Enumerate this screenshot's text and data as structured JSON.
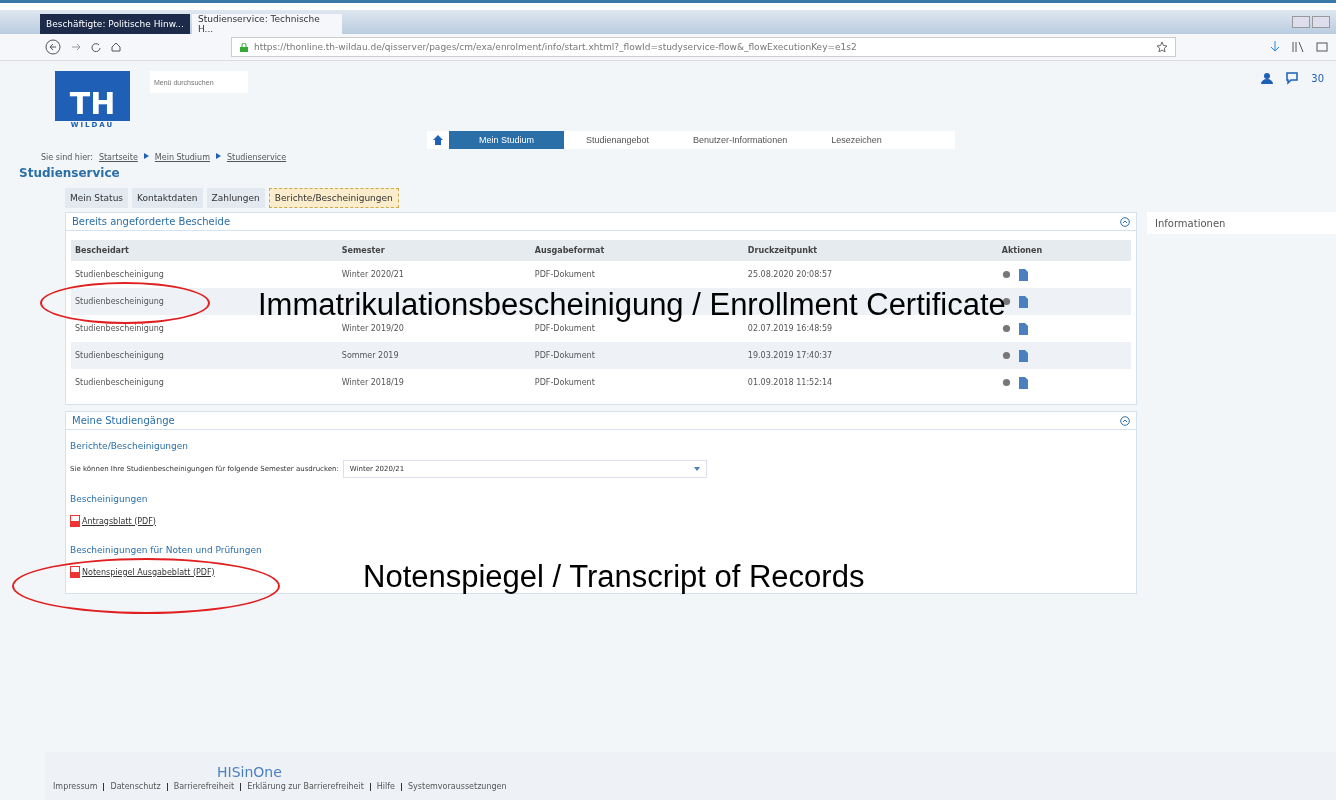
{
  "browser": {
    "tabs": [
      {
        "title": "Beschäftigte: Politische Hinw...",
        "selected": false
      },
      {
        "title": "Studienservice: Technische H...",
        "selected": true
      }
    ],
    "url": "https://thonline.th-wildau.de/qisserver/pages/cm/exa/enrolment/info/start.xhtml?_flowId=studyservice-flow&_flowExecutionKey=e1s2"
  },
  "header": {
    "logo_text": "TH",
    "logo_subtext": "WILDAU",
    "search": {
      "placeholder": "Menü durchsuchen"
    },
    "message_count": "30",
    "nav": [
      {
        "label": "Mein Studium",
        "selected": true
      },
      {
        "label": "Studienangebot",
        "selected": false
      },
      {
        "label": "Benutzer-Informationen",
        "selected": false
      },
      {
        "label": "Lesezeichen",
        "selected": false
      }
    ]
  },
  "breadcrumb": {
    "prefix": "Sie sind hier:",
    "items": [
      "Startseite",
      "Mein Studium",
      "Studienservice"
    ]
  },
  "page_title": "Studienservice",
  "tabs": [
    {
      "label": "Mein Status",
      "selected": false
    },
    {
      "label": "Kontaktdaten",
      "selected": false
    },
    {
      "label": "Zahlungen",
      "selected": false
    },
    {
      "label": "Berichte/Bescheinigungen",
      "selected": true
    }
  ],
  "requested": {
    "title": "Bereits angeforderte Bescheide",
    "columns": [
      "Bescheidart",
      "Semester",
      "Ausgabeformat",
      "Druckzeitpunkt",
      "Aktionen"
    ],
    "rows": [
      {
        "cells": [
          "Studienbescheinigung",
          "Winter 2020/21",
          "PDF-Dokument",
          "25.08.2020 20:08:57"
        ]
      },
      {
        "cells": [
          "Studienbescheinigung"
        ]
      },
      {
        "cells": [
          "Studienbescheinigung",
          "Winter 2019/20",
          "PDF-Dokument",
          "02.07.2019 16:48:59"
        ]
      },
      {
        "cells": [
          "Studienbescheinigung",
          "Sommer 2019",
          "PDF-Dokument",
          "19.03.2019 17:40:37"
        ]
      },
      {
        "cells": [
          "Studienbescheinigung",
          "Winter 2018/19",
          "PDF-Dokument",
          "01.09.2018 11:52:14"
        ]
      }
    ]
  },
  "programs": {
    "title": "Meine Studiengänge",
    "subtitle": "Berichte/Bescheinigungen",
    "select_label": "Sie können Ihre Studienbescheinigungen für folgende Semester ausdrucken:",
    "select_value": "Winter 2020/21",
    "groups": [
      {
        "heading": "Bescheinigungen",
        "link": "Antragsblatt (PDF)"
      },
      {
        "heading": "Bescheinigungen für Noten und Prüfungen",
        "link": "Notenspiegel Ausgabeblatt (PDF)"
      }
    ]
  },
  "side_panel": {
    "title": "Informationen"
  },
  "footer": {
    "logo": "HISinOne",
    "links": [
      "Impressum",
      "Datenschutz",
      "Barrierefreiheit",
      "Erklärung zur Barrierefreiheit",
      "Hilfe",
      "Systemvoraussetzungen"
    ]
  },
  "annotations": [
    {
      "text": "Immatrikulationsbescheinigung / Enrollment Certificate"
    },
    {
      "text": "Notenspiegel / Transcript of Records"
    }
  ]
}
